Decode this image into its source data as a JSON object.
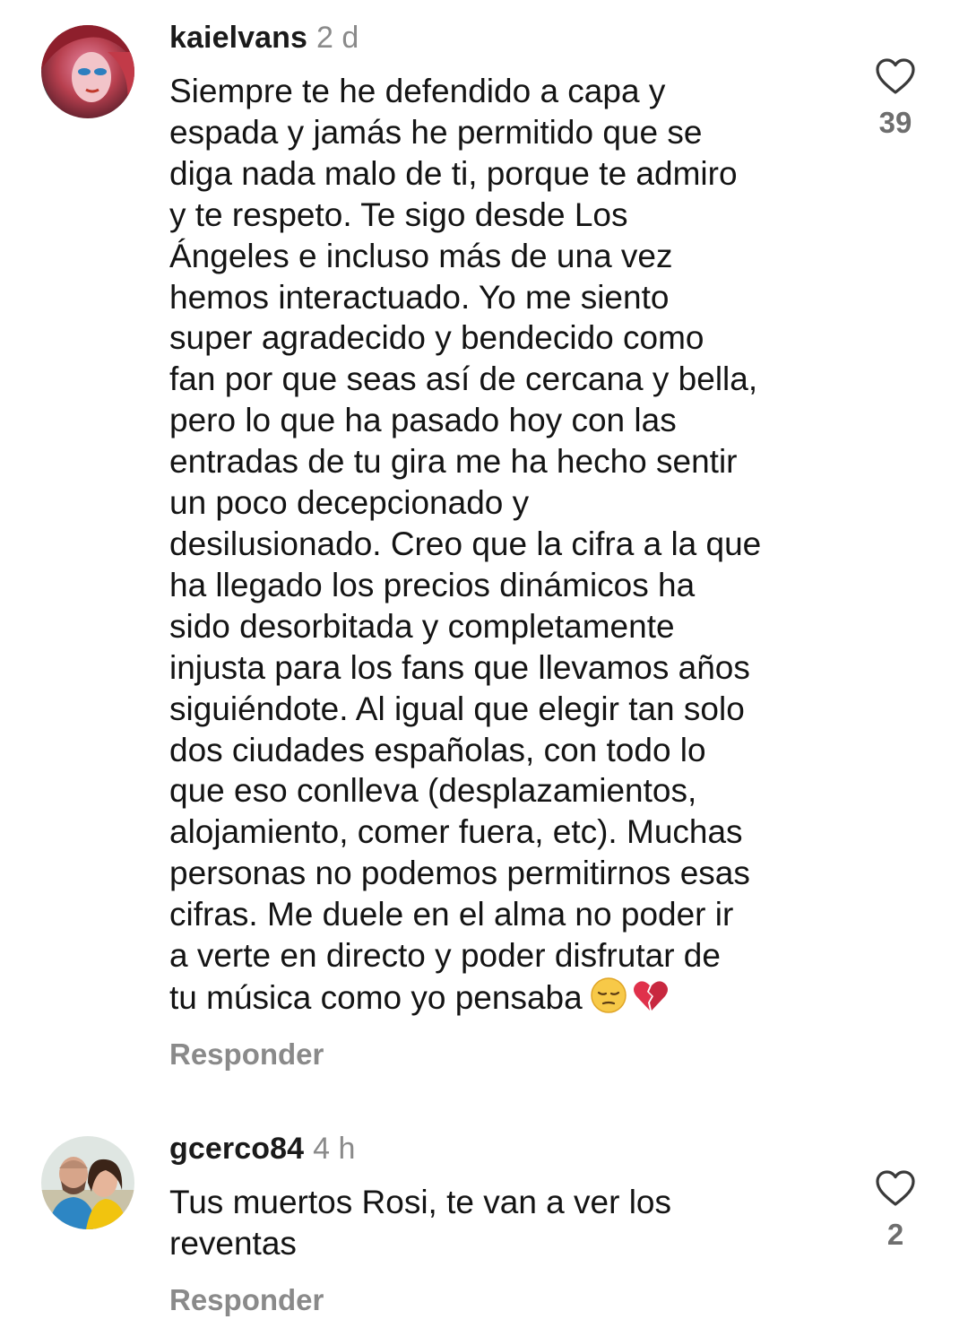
{
  "comments": [
    {
      "username": "kaielvans",
      "time": "2 d",
      "text": "Siempre te he defendido a capa y\nespada y jamás he permitido que se\ndiga nada malo de ti, porque te admiro\ny te respeto. Te sigo desde Los\nÁngeles e incluso más de una vez\nhemos interactuado. Yo me siento\nsuper agradecido y bendecido como\nfan por que seas así de cercana y bella,\npero lo que ha pasado hoy con las\nentradas de tu gira me ha hecho sentir\nun poco decepcionado y\ndesilusionado. Creo que la cifra a la que\nha llegado los precios dinámicos ha\nsido desorbitada y completamente\ninjusta para los fans que llevamos años\nsiguiéndote. Al igual que elegir tan solo\ndos ciudades españolas, con todo lo\nque eso conlleva (desplazamientos,\nalojamiento, comer fuera, etc). Muchas\npersonas no podemos permitirnos esas\ncifras. Me duele en el alma no poder ir\na verte en directo y poder disfrutar de\ntu música como yo pensaba",
      "emojis": [
        "pensive-face-emoji",
        "broken-heart-emoji"
      ],
      "reply_label": "Responder",
      "likes": "39",
      "like_icon": "heart-outline-icon"
    },
    {
      "username": "gcerco84",
      "time": "4 h",
      "text": "Tus muertos Rosi, te van a ver los\nreventas",
      "reply_label": "Responder",
      "likes": "2",
      "like_icon": "heart-outline-icon"
    }
  ],
  "colors": {
    "username": "#1a1a1a",
    "secondary_text": "#8a8a8a",
    "body_text": "#141414"
  }
}
